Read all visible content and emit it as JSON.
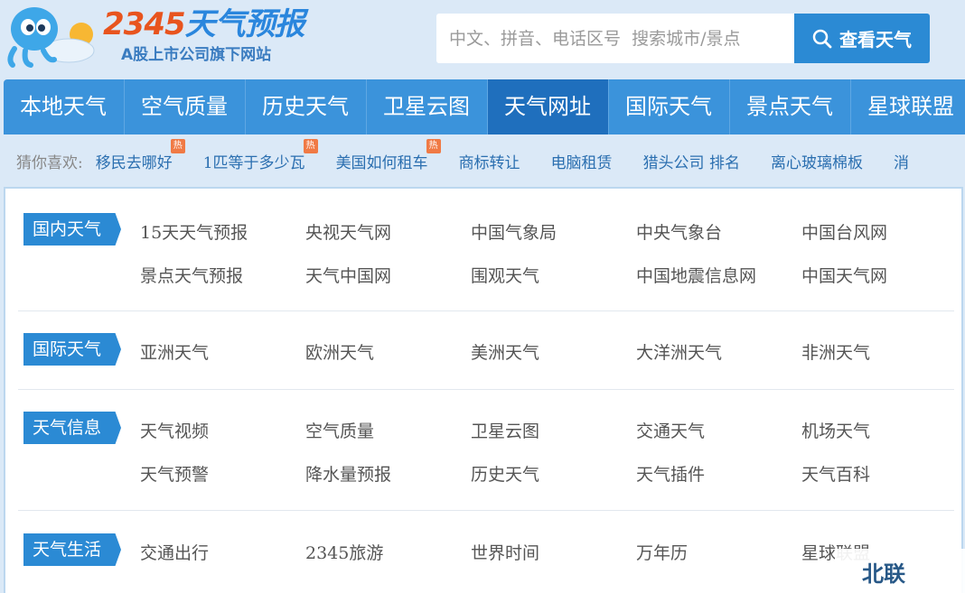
{
  "header": {
    "logo_number": "2345",
    "logo_text": "天气预报",
    "logo_sub": "A股上市公司旗下网站",
    "search_placeholder": "中文、拼音、电话区号  搜索城市/景点",
    "search_button": "查看天气"
  },
  "nav": {
    "items": [
      {
        "label": "本地天气"
      },
      {
        "label": "空气质量"
      },
      {
        "label": "历史天气"
      },
      {
        "label": "卫星云图"
      },
      {
        "label": "天气网址"
      },
      {
        "label": "国际天气"
      },
      {
        "label": "景点天气"
      },
      {
        "label": "星球联盟"
      }
    ],
    "active_index": 4
  },
  "guess": {
    "label": "猜你喜欢:",
    "hot_badge": "热",
    "links": [
      {
        "label": "移民去哪好"
      },
      {
        "label": "1匹等于多少瓦"
      },
      {
        "label": "美国如何租车"
      },
      {
        "label": "商标转让"
      },
      {
        "label": "电脑租赁"
      },
      {
        "label": "猎头公司 排名"
      },
      {
        "label": "离心玻璃棉板"
      },
      {
        "label": "消"
      }
    ]
  },
  "sections": [
    {
      "tag": "国内天气",
      "links": [
        "15天天气预报",
        "央视天气网",
        "中国气象局",
        "中央气象台",
        "中国台风网",
        "景点天气预报",
        "天气中国网",
        "围观天气",
        "中国地震信息网",
        "中国天气网"
      ]
    },
    {
      "tag": "国际天气",
      "links": [
        "亚洲天气",
        "欧洲天气",
        "美洲天气",
        "大洋洲天气",
        "非洲天气"
      ]
    },
    {
      "tag": "天气信息",
      "links": [
        "天气视频",
        "空气质量",
        "卫星云图",
        "交通天气",
        "机场天气",
        "天气预警",
        "降水量预报",
        "历史天气",
        "天气插件",
        "天气百科"
      ]
    },
    {
      "tag": "天气生活",
      "links": [
        "交通出行",
        "2345旅游",
        "世界时间",
        "万年历",
        "星球联盟"
      ]
    }
  ],
  "watermark": "北联",
  "colors": {
    "brand_blue": "#2b8ad4",
    "nav_active": "#1f6fbd",
    "logo_orange": "#e8541e",
    "link_blue": "#2b6fb0"
  }
}
